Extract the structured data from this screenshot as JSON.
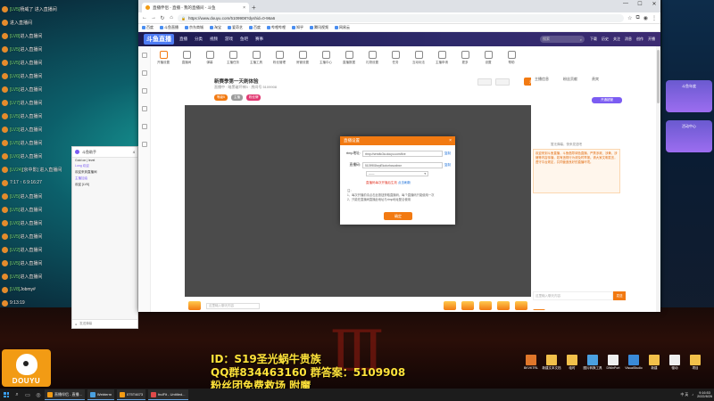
{
  "stream_chat": [
    {
      "level": "[LV5]",
      "text": "杨威了 进入直播间"
    },
    {
      "level": "",
      "text": "进入直播间"
    },
    {
      "level": "[LV8]",
      "text": "进入直播间"
    },
    {
      "level": "[LV5]",
      "text": "进入直播间"
    },
    {
      "level": "[LV5]",
      "text": "进入直播间"
    },
    {
      "level": "[LV6]",
      "text": "进入直播间"
    },
    {
      "level": "[LV5]",
      "text": "进入直播间"
    },
    {
      "level": "[LV7]",
      "text": "进入直播间"
    },
    {
      "level": "[LV5]",
      "text": "进入直播间"
    },
    {
      "level": "[LV3]",
      "text": "进入直播间"
    },
    {
      "level": "[LV5]",
      "text": "进入直播间"
    },
    {
      "level": "[LV6]",
      "text": "进入直播间"
    },
    {
      "level": "[LV24]",
      "text": "[京中影] 进入直播间"
    },
    {
      "level": "",
      "text": "7:17 ↑ 6 9:16:27"
    },
    {
      "level": "[LV5]",
      "text": "进入直播间"
    },
    {
      "level": "[LV5]",
      "text": "进入直播间"
    },
    {
      "level": "[LV6]",
      "text": "进入直播间"
    },
    {
      "level": "[LV5]",
      "text": "进入直播间"
    },
    {
      "level": "[LV2]",
      "text": "进入直播间"
    },
    {
      "level": "[LV5]",
      "text": "进入直播间"
    },
    {
      "level": "[LV5]",
      "text": "进入直播间"
    },
    {
      "level": "[LV8]",
      "text": "Jobmy#"
    },
    {
      "level": "",
      "text": "9:13:19"
    }
  ],
  "stream_info": {
    "line1": "ID：S19圣光蜗牛贵族",
    "line2": "QQ群834463160 群答案：5109908",
    "line3": "粉丝团免费救场 附魔"
  },
  "douyu_logo": {
    "word": "DOUYU"
  },
  "desktop_icons": [
    {
      "label": "BKVKTRL",
      "color": "#e0762a"
    },
    {
      "label": "新建文本文档",
      "color": "#f2c04a"
    },
    {
      "label": "临时",
      "color": "#f2c04a"
    },
    {
      "label": "图片转换工具",
      "color": "#4aa0e0"
    },
    {
      "label": "DWinPort",
      "color": "#eee"
    },
    {
      "label": "VisualStudio",
      "color": "#3a8ad8"
    },
    {
      "label": "新建",
      "color": "#f2c04a"
    },
    {
      "label": "驱动",
      "color": "#eee"
    },
    {
      "label": "项目",
      "color": "#f2c04a"
    }
  ],
  "browser": {
    "tab_title": "直播伴侣 - 直播 - 我的直播间 - 斗鱼",
    "url": "https://www.douyu.com/5109908?dyshid=0-96a6",
    "bookmarks": [
      "百度",
      "斗鱼直播",
      "京东商城",
      "淘宝",
      "爱奇艺",
      "百度",
      "哔哩哔哩",
      "知乎",
      "腾讯视频",
      "网易云"
    ],
    "window_controls": [
      "—",
      "☐",
      "✕"
    ]
  },
  "douyu_header": {
    "brand": "斗鱼直播",
    "nav": [
      "直播",
      "分类",
      "视频",
      "游戏",
      "鱼吧",
      "赛事"
    ],
    "search_placeholder": "搜索",
    "right_icons": [
      "下载",
      "历史",
      "关注",
      "消息",
      "创作",
      "开播"
    ]
  },
  "toolbar": [
    "开播设置",
    "直播间",
    "弹幕",
    "主播任务",
    "主播工具",
    "粉丝管理",
    "房管设置",
    "主播中心",
    "直播数据",
    "礼物设置",
    "任务",
    "互动玩法",
    "主播申请",
    "更多",
    "设置",
    "帮助"
  ],
  "room": {
    "title": "新赛季第一天刷体验",
    "meta": "直播中 · 暗黑破坏神3 · 房间号 5109908",
    "badges": [
      "等级5",
      "主播",
      "粉丝牌"
    ],
    "follow": "关注"
  },
  "dialog": {
    "title": "直播设置",
    "close": "×",
    "rtmp_label": "rtmp地址:",
    "rtmp_value": "rtmp://sendtc3a.douyu.com/live",
    "copy": "复制",
    "key_label": "直播码:",
    "key_value": "5109908rvpEkotorhcsuxbwr",
    "copy2": "复制",
    "select_value": "——",
    "warning": "直播码每次开播后生效",
    "warning_link": "点击刷新",
    "notes": [
      "注：",
      "1、每次开播前请点击此按钮获取直播码，每个直播码只能使用一次",
      "2、只能在直播间直播此地址与rtmp地址配合使用"
    ],
    "ok": "确定"
  },
  "right_col": {
    "tabs": [
      "主播信息",
      "粉丝贡献",
      "贵宾"
    ],
    "button": "开通超管",
    "subtitle": "暂无弹幕，快来发送吧",
    "notice": "欢迎来到斗鱼直播，斗鱼倡导绿色直播，严禁涉政、涉黄、涉赌等内容传播，若有违规行为请及时举报。请大家文明发言，遵守平台规定，共同营造良好的直播环境。",
    "chat_placeholder": "这里输入聊天内容",
    "send": "发送"
  },
  "below_video": {
    "input_placeholder": "这里输入聊天内容"
  },
  "assistant": {
    "title": "斗鱼助手",
    "count": "4",
    "messages": [
      "Gold on | level",
      "Long 欢迎",
      "欢迎来到直播间",
      "主播加油",
      "欢迎 [LV5]"
    ],
    "footer": "发送弹幕"
  },
  "right_banner": [
    "斗鱼年度",
    "活动中心"
  ],
  "taskbar": {
    "tasks": [
      {
        "label": "直播伴侣 - 直播...",
        "color": "#f29b14"
      },
      {
        "label": "Webterm",
        "color": "#4aa0e0"
      },
      {
        "label": "075T4673",
        "color": "#f29b14"
      },
      {
        "label": "fndFit - Untitled...",
        "color": "#e04a4a"
      }
    ],
    "clock_time": "9:16:53",
    "clock_date": "2022/8/26",
    "tray": "中 英"
  }
}
